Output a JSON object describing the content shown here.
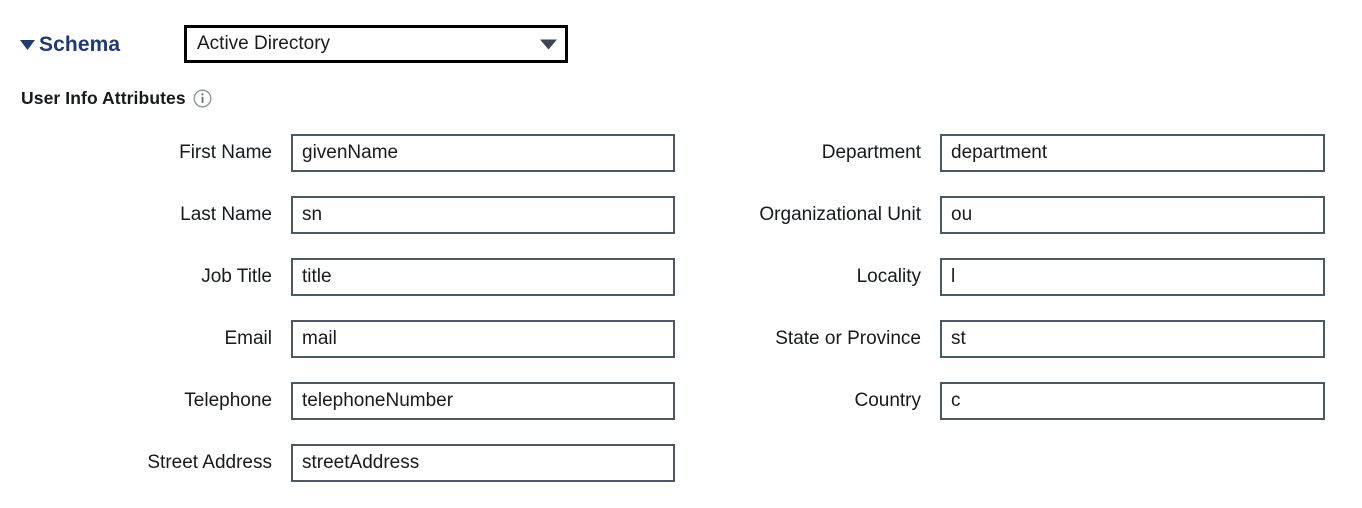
{
  "section": {
    "toggle_icon": "triangle-down-icon",
    "title": "Schema",
    "title_color": "#1f3a73"
  },
  "schema_select": {
    "name": "schema-dropdown",
    "selected": "Active Directory",
    "arrow_icon": "chevron-down-icon",
    "options": [
      "Active Directory"
    ]
  },
  "subheading": {
    "text": "User Info Attributes",
    "info_icon": "info-icon"
  },
  "form": {
    "left_column": [
      {
        "label": "First Name",
        "value": "givenName",
        "placeholder": ""
      },
      {
        "label": "Last Name",
        "value": "sn",
        "placeholder": ""
      },
      {
        "label": "Job Title",
        "value": "title",
        "placeholder": ""
      },
      {
        "label": "Email",
        "value": "mail",
        "placeholder": ""
      },
      {
        "label": "Telephone",
        "value": "telephoneNumber",
        "placeholder": ""
      },
      {
        "label": "Street Address",
        "value": "streetAddress",
        "placeholder": ""
      }
    ],
    "right_column": [
      {
        "label": "Department",
        "value": "department",
        "placeholder": ""
      },
      {
        "label": "Organizational Unit",
        "value": "ou",
        "placeholder": ""
      },
      {
        "label": "Locality",
        "value": "l",
        "placeholder": ""
      },
      {
        "label": "State or Province",
        "value": "st",
        "placeholder": ""
      },
      {
        "label": "Country",
        "value": "c",
        "placeholder": ""
      }
    ]
  },
  "colors": {
    "background": "#ffffff",
    "text": "#16191d",
    "section_title": "#1f3a73",
    "input_border": "#4c5764",
    "select_border": "#000000",
    "icon_gray": "#6b7280"
  }
}
